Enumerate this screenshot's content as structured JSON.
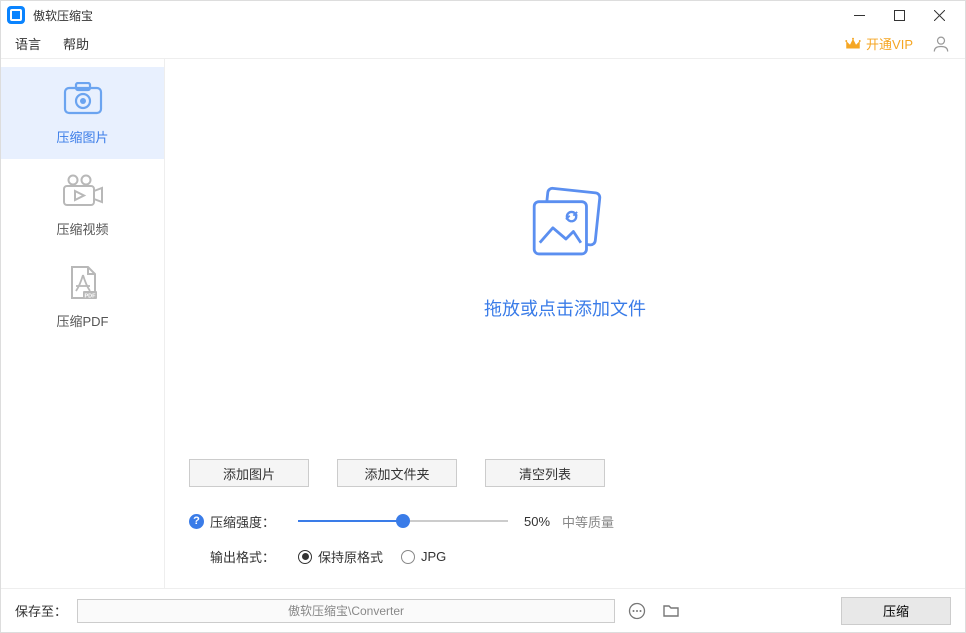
{
  "app": {
    "title": "傲软压缩宝"
  },
  "menu": {
    "language": "语言",
    "help": "帮助",
    "vip": "开通VIP"
  },
  "sidebar": {
    "items": [
      {
        "id": "image",
        "label": "压缩图片",
        "active": true
      },
      {
        "id": "video",
        "label": "压缩视频",
        "active": false
      },
      {
        "id": "pdf",
        "label": "压缩PDF",
        "active": false
      }
    ]
  },
  "dropzone": {
    "hint": "拖放或点击添加文件"
  },
  "controls": {
    "add_image": "添加图片",
    "add_folder": "添加文件夹",
    "clear_list": "清空列表",
    "strength_label": "压缩强度：",
    "strength_value": 50,
    "strength_display": "50%",
    "strength_hint": "中等质量",
    "output_label": "输出格式：",
    "output_options": [
      {
        "id": "keep",
        "label": "保持原格式",
        "checked": true
      },
      {
        "id": "jpg",
        "label": "JPG",
        "checked": false
      }
    ]
  },
  "footer": {
    "save_label": "保存至：",
    "save_path": "傲软压缩宝\\Converter",
    "compress": "压缩"
  }
}
